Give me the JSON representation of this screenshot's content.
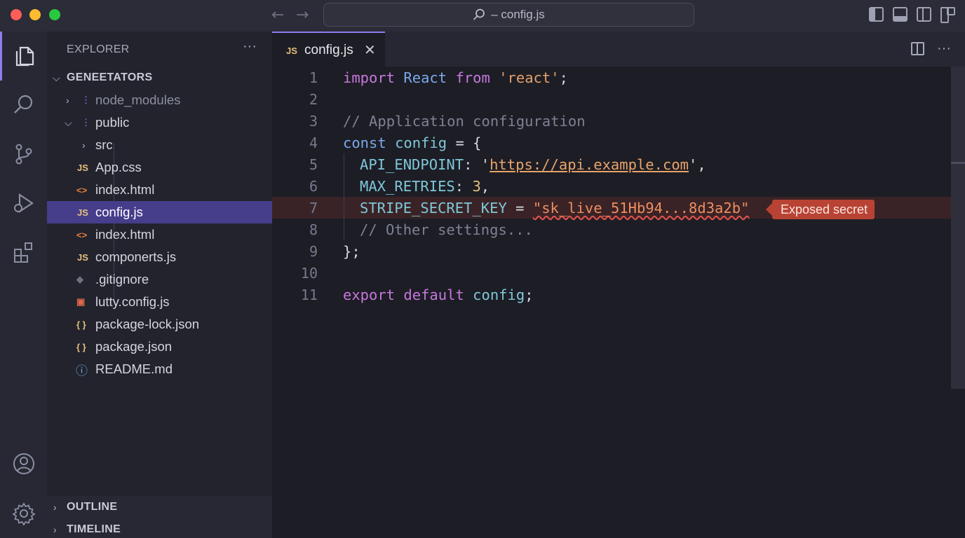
{
  "window": {
    "command_center": "– config.js",
    "colors": {
      "accent": "#8e7cf0",
      "selection": "#463d8b",
      "error": "#b84334"
    }
  },
  "activity_bar": {
    "items": [
      "explorer-icon",
      "search-icon",
      "source-control-icon",
      "run-debug-icon",
      "extensions-icon"
    ],
    "bottom": [
      "account-icon",
      "settings-gear-icon"
    ]
  },
  "explorer": {
    "header": "EXPLORER",
    "more": "···",
    "project": "GENEETATORS",
    "tree": [
      {
        "name": "node_modules",
        "type": "folder",
        "expanded": false
      },
      {
        "name": "public",
        "type": "folder",
        "expanded": true
      },
      {
        "name": "src",
        "type": "folder",
        "expanded": false
      },
      {
        "name": "App.css",
        "icon": "JS"
      },
      {
        "name": "index.html",
        "icon": "<>"
      },
      {
        "name": "config.js",
        "icon": "JS",
        "selected": true
      },
      {
        "name": "index.html",
        "icon": "<>"
      },
      {
        "name": "componerts.js",
        "icon": "JS"
      },
      {
        "name": ".gitignore",
        "icon": "◆"
      },
      {
        "name": "lutty.config.js",
        "icon": "▣"
      },
      {
        "name": "package-lock.json",
        "icon": "{ }"
      },
      {
        "name": "package.json",
        "icon": "{ }"
      },
      {
        "name": "README.md",
        "icon": "ⓘ"
      }
    ],
    "outline": "OUTLINE",
    "timeline": "TIMELINE"
  },
  "editor": {
    "tab": {
      "badge": "JS",
      "label": "config.js",
      "close": "✕"
    },
    "line_numbers": [
      "1",
      "2",
      "3",
      "4",
      "5",
      "6",
      "7",
      "8",
      "9",
      "10",
      "11"
    ],
    "code": {
      "l1": {
        "a": "import",
        "b": "React",
        "c": "from",
        "d": "'react'",
        "e": ";"
      },
      "l3": "// Application configuration",
      "l4": {
        "a": "const",
        "b": "config",
        "c": " = {"
      },
      "l5": {
        "a": "API_ENDPOINT",
        "b": ": '",
        "c": "https://api.example.com",
        "d": "',",
        "q": ""
      },
      "l6": {
        "a": "MAX_RETRIES",
        "b": ": ",
        "c": "3",
        "d": ","
      },
      "l7": {
        "a": "STRIPE_SECRET_KEY",
        "b": " = ",
        "c": "\"sk_live_51Hb94...8d3a2b\""
      },
      "l8": "// Other settings...",
      "l9": "};",
      "l11": {
        "a": "export",
        "b": "default",
        "c": "config",
        "d": ";"
      }
    },
    "diagnostic": "Exposed secret"
  }
}
